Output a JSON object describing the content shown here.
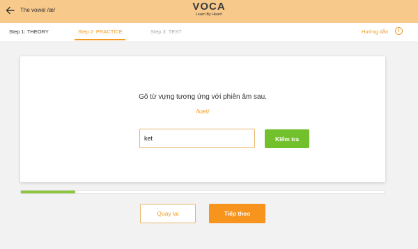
{
  "header": {
    "lesson_title": "The vowel /æ/",
    "logo_text": "VOCA",
    "logo_tagline": "Learn By Heart!"
  },
  "steps": {
    "step1": "Step 1: THEORY",
    "step2": "Step 2: PRACTICE",
    "step3": "Step 3: TEST",
    "active": "step2"
  },
  "guide": {
    "label": "Hướng dẫn",
    "icon": "info-icon"
  },
  "exercise": {
    "prompt": "Gõ từ vựng tương ứng với phiên âm sau.",
    "phonetic": "/kæt/",
    "answer_value": "ket",
    "check_label": "Kiểm tra"
  },
  "progress": {
    "fraction": 0.15
  },
  "nav": {
    "back_label": "Quay lại",
    "next_label": "Tiếp theo"
  },
  "colors": {
    "topbar": "#f7c98b",
    "accent": "#f39a1e",
    "check_green": "#72c02c",
    "progress_green": "#8cc63f"
  }
}
